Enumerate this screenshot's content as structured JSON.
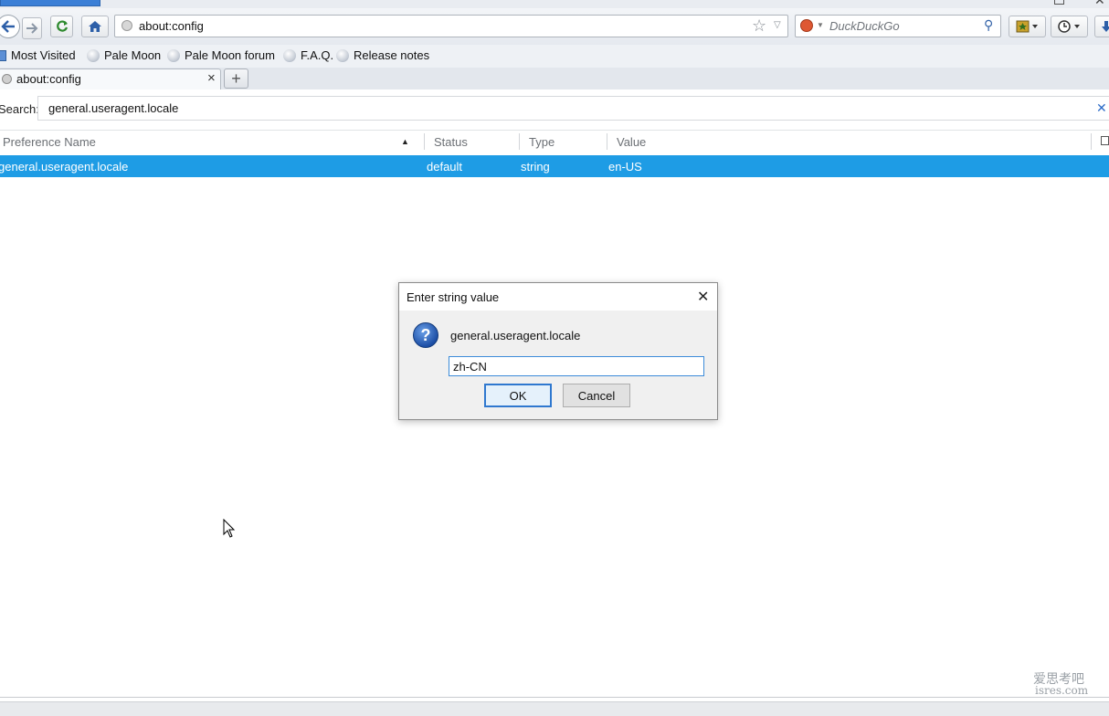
{
  "navbar": {
    "url": "about:config",
    "search_placeholder": "DuckDuckGo"
  },
  "bookmarks": [
    {
      "label": "Most Visited"
    },
    {
      "label": "Pale Moon"
    },
    {
      "label": "Pale Moon forum"
    },
    {
      "label": "F.A.Q."
    },
    {
      "label": "Release notes"
    }
  ],
  "tab": {
    "title": "about:config",
    "close": "×",
    "new_tab": "+"
  },
  "config": {
    "search_label": "Search:",
    "search_value": "general.useragent.locale",
    "columns": {
      "name": "Preference Name",
      "status": "Status",
      "type": "Type",
      "value": "Value"
    },
    "rows": [
      {
        "name": "general.useragent.locale",
        "status": "default",
        "type": "string",
        "value": "en-US"
      }
    ]
  },
  "dialog": {
    "title": "Enter string value",
    "message": "general.useragent.locale",
    "input_value": "zh-CN",
    "ok_label": "OK",
    "cancel_label": "Cancel"
  },
  "watermark": {
    "line1": "爱思考吧",
    "line2": "isres.com"
  },
  "colors": {
    "selection": "#1e9ce5",
    "dialog_focus": "#2f78cf"
  }
}
